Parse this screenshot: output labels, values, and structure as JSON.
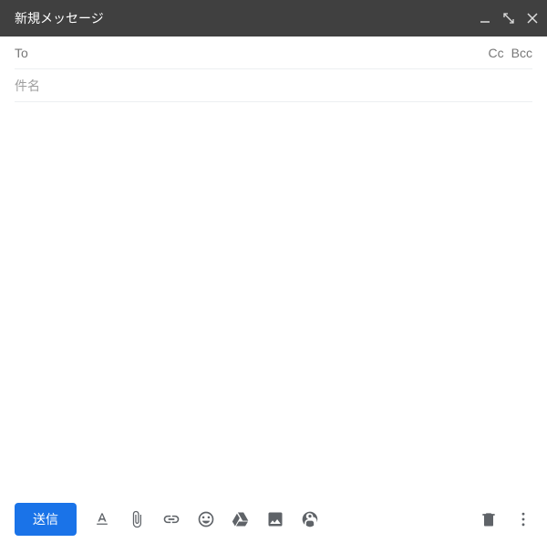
{
  "titlebar": {
    "title": "新規メッセージ"
  },
  "fields": {
    "to_label": "To",
    "to_value": "",
    "cc_label": "Cc",
    "bcc_label": "Bcc",
    "subject_placeholder": "件名",
    "subject_value": ""
  },
  "body": {
    "content": ""
  },
  "toolbar": {
    "send_label": "送信"
  }
}
